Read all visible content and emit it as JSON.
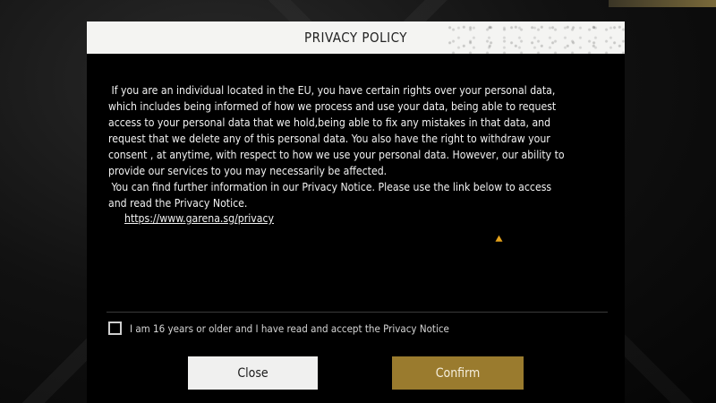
{
  "dialog": {
    "title": "PRIVACY POLICY",
    "body_lines": [
      " If you are an individual located in the EU, you have certain rights over your personal data,",
      "which includes being informed of how we process and use your data, being able to request",
      "access to your personal data that we hold,being able to fix any mistakes in that data, and",
      "request that we delete any of this personal data. You also have the right to withdraw your",
      "consent , at anytime, with respect to how we use your personal data. However, our ability to",
      "provide our services to you may necessarily be affected.",
      " You can find further information in our Privacy Notice. Please use the link below to access",
      "and read the Privacy Notice."
    ],
    "link_text": "https://www.garena.sg/privacy",
    "consent_label": "I am 16 years or older and I have read and accept the Privacy Notice",
    "close_label": "Close",
    "confirm_label": "Confirm"
  },
  "colors": {
    "dialog_bg": "#000000",
    "title_bar": "#f4f4f2",
    "confirm_button": "#9a7b2e",
    "close_button": "#f0f0ef",
    "cursor": "#e5a21b"
  }
}
